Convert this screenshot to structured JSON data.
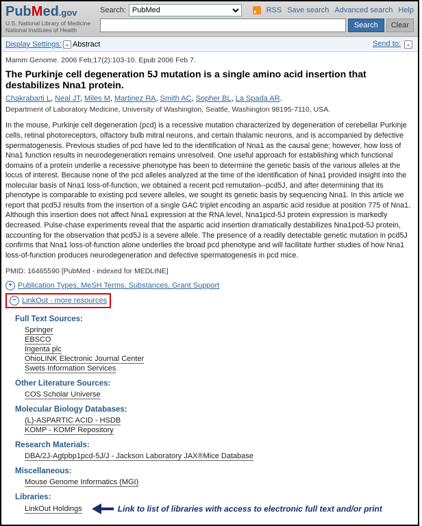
{
  "header": {
    "logo_sub1": "U.S. National Library of Medicine",
    "logo_sub2": "National Institutes of Health",
    "search_label": "Search:",
    "search_select": "PubMed",
    "rss": "RSS",
    "save_search": "Save search",
    "advanced": "Advanced search",
    "help": "Help",
    "search_btn": "Search",
    "clear_btn": "Clear"
  },
  "subbar": {
    "display_settings": "Display Settings:",
    "abstract": "Abstract",
    "send_to": "Send to:"
  },
  "article": {
    "citation": "Mamm Genome. 2006 Feb;17(2):103-10. Epub 2006 Feb 7.",
    "title": "The Purkinje cell degeneration 5J mutation is a single amino acid insertion that destabilizes Nna1 protein.",
    "authors": [
      "Chakrabarti L",
      "Neal JT",
      "Miles M",
      "Martinez RA",
      "Smith AC",
      "Sopher BL",
      "La Spada AR"
    ],
    "affil": "Department of Laboratory Medicine, University of Washington, Seattle, Washington 98195-7110, USA.",
    "abstract": "In the mouse, Purkinje cell degeneration (pcd) is a recessive mutation characterized by degeneration of cerebellar Purkinje cells, retinal photoreceptors, olfactory bulb mitral neurons, and certain thalamic neurons, and is accompanied by defective spermatogenesis. Previous studies of pcd have led to the identification of Nna1 as the causal gene; however, how loss of Nna1 function results in neurodegeneration remains unresolved. One useful approach for establishing which functional domains of a protein underlie a recessive phenotype has been to determine the genetic basis of the various alleles at the locus of interest. Because none of the pcd alleles analyzed at the time of the identification of Nna1 provided insight into the molecular basis of Nna1 loss-of-function, we obtained a recent pcd remutation--pcd5J, and after determining that its phenotype is comparable to existing pcd severe alleles, we sought its genetic basis by sequencing Nna1. In this article we report that pcd5J results from the insertion of a single GAC triplet encoding an aspartic acid residue at position 775 of Nna1. Although this insertion does not affect Nna1 expression at the RNA level, Nna1pcd-5J protein expression is markedly decreased. Pulse-chase experiments reveal that the aspartic acid insertion dramatically destabilizes Nna1pcd-5J protein, accounting for the observation that pcd5J is a severe allele. The presence of a readily detectable genetic mutation in pcd5J confirms that Nna1 loss-of-function alone underlies the broad pcd phenotype and will facilitate further studies of how Nna1 loss-of-function produces neurodegeneration and defective spermatogenesis in pcd mice.",
    "pmid": "PMID: 16465590 [PubMed - indexed for MEDLINE]"
  },
  "expanders": {
    "pubtypes": "Publication Types, MeSH Terms, Substances, Grant Support",
    "linkout": "LinkOut - more resources"
  },
  "sections": {
    "fulltext": {
      "heading": "Full Text Sources:",
      "links": [
        "Springer",
        "EBSCO",
        "Ingenta plc",
        "OhioLINK Electronic Journal Center",
        "Swets Information Services"
      ]
    },
    "otherlit": {
      "heading": "Other Literature Sources:",
      "links": [
        "COS Scholar Universe"
      ]
    },
    "molbio": {
      "heading": "Molecular Biology Databases:",
      "links": [
        "(L)-ASPARTIC ACID - HSDB",
        "KOMP - KOMP Repository"
      ]
    },
    "research": {
      "heading": "Research Materials:",
      "links": [
        "DBA/2J-Agtpbp1pcd-5J/J - Jackson Laboratory JAX®Mice Database"
      ]
    },
    "misc": {
      "heading": "Miscellaneous:",
      "links": [
        "Mouse Genome Informatics (MGI)"
      ]
    },
    "libraries": {
      "heading": "Libraries:",
      "link": "LinkOut Holdings",
      "annotation": "Link to list of libraries with access to electronic full text and/or print"
    }
  }
}
